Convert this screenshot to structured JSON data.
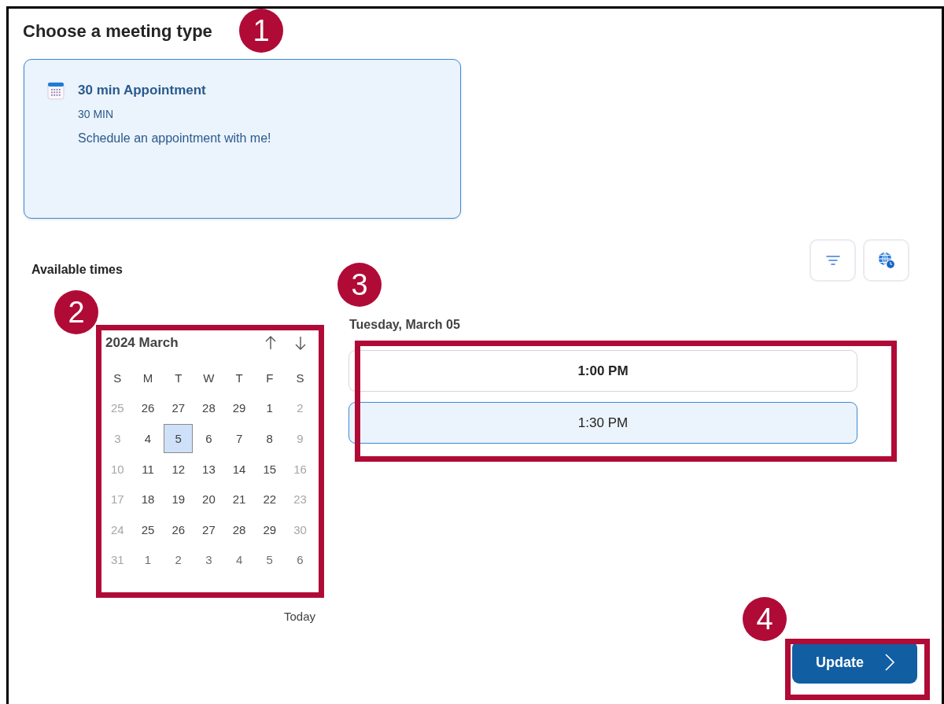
{
  "heading": "Choose a meeting type",
  "meeting_types": [
    {
      "title": "30 min Appointment",
      "duration": "30 MIN",
      "description": "Schedule an appointment with me!",
      "selected": true
    }
  ],
  "available_times_label": "Available times",
  "calendar": {
    "title": "2024 March",
    "weekdays": [
      "S",
      "M",
      "T",
      "W",
      "T",
      "F",
      "S"
    ],
    "weeks": [
      [
        {
          "day": "25",
          "kind": "disabled",
          "selected": false
        },
        {
          "day": "26",
          "kind": "available",
          "selected": false
        },
        {
          "day": "27",
          "kind": "available",
          "selected": false
        },
        {
          "day": "28",
          "kind": "available",
          "selected": false
        },
        {
          "day": "29",
          "kind": "available",
          "selected": false
        },
        {
          "day": "1",
          "kind": "available",
          "selected": false
        },
        {
          "day": "2",
          "kind": "disabled",
          "selected": false
        }
      ],
      [
        {
          "day": "3",
          "kind": "disabled",
          "selected": false
        },
        {
          "day": "4",
          "kind": "available",
          "selected": false
        },
        {
          "day": "5",
          "kind": "available",
          "selected": true
        },
        {
          "day": "6",
          "kind": "available",
          "selected": false
        },
        {
          "day": "7",
          "kind": "available",
          "selected": false
        },
        {
          "day": "8",
          "kind": "available",
          "selected": false
        },
        {
          "day": "9",
          "kind": "disabled",
          "selected": false
        }
      ],
      [
        {
          "day": "10",
          "kind": "disabled",
          "selected": false
        },
        {
          "day": "11",
          "kind": "available",
          "selected": false
        },
        {
          "day": "12",
          "kind": "available",
          "selected": false
        },
        {
          "day": "13",
          "kind": "available",
          "selected": false
        },
        {
          "day": "14",
          "kind": "available",
          "selected": false
        },
        {
          "day": "15",
          "kind": "available",
          "selected": false
        },
        {
          "day": "16",
          "kind": "disabled",
          "selected": false
        }
      ],
      [
        {
          "day": "17",
          "kind": "disabled",
          "selected": false
        },
        {
          "day": "18",
          "kind": "available",
          "selected": false
        },
        {
          "day": "19",
          "kind": "available",
          "selected": false
        },
        {
          "day": "20",
          "kind": "available",
          "selected": false
        },
        {
          "day": "21",
          "kind": "available",
          "selected": false
        },
        {
          "day": "22",
          "kind": "available",
          "selected": false
        },
        {
          "day": "23",
          "kind": "disabled",
          "selected": false
        }
      ],
      [
        {
          "day": "24",
          "kind": "disabled",
          "selected": false
        },
        {
          "day": "25",
          "kind": "available",
          "selected": false
        },
        {
          "day": "26",
          "kind": "available",
          "selected": false
        },
        {
          "day": "27",
          "kind": "available",
          "selected": false
        },
        {
          "day": "28",
          "kind": "available",
          "selected": false
        },
        {
          "day": "29",
          "kind": "available",
          "selected": false
        },
        {
          "day": "30",
          "kind": "disabled",
          "selected": false
        }
      ],
      [
        {
          "day": "31",
          "kind": "disabled",
          "selected": false
        },
        {
          "day": "1",
          "kind": "next_month",
          "selected": false
        },
        {
          "day": "2",
          "kind": "next_month",
          "selected": false
        },
        {
          "day": "3",
          "kind": "next_month",
          "selected": false
        },
        {
          "day": "4",
          "kind": "next_month",
          "selected": false
        },
        {
          "day": "5",
          "kind": "next_month",
          "selected": false
        },
        {
          "day": "6",
          "kind": "next_month",
          "selected": false
        }
      ]
    ]
  },
  "today_link": "Today",
  "selected_date_label": "Tuesday, March 05",
  "time_slots": [
    {
      "label": "1:00 PM",
      "selected": false
    },
    {
      "label": "1:30 PM",
      "selected": true
    }
  ],
  "update_button": {
    "label": "Update"
  },
  "callouts": [
    {
      "number": "1",
      "kind": "meeting",
      "framed": false
    },
    {
      "number": "2",
      "kind": "calendar",
      "framed": true
    },
    {
      "number": "3",
      "kind": "slots",
      "framed": true
    },
    {
      "number": "4",
      "kind": "update",
      "framed": true
    }
  ]
}
